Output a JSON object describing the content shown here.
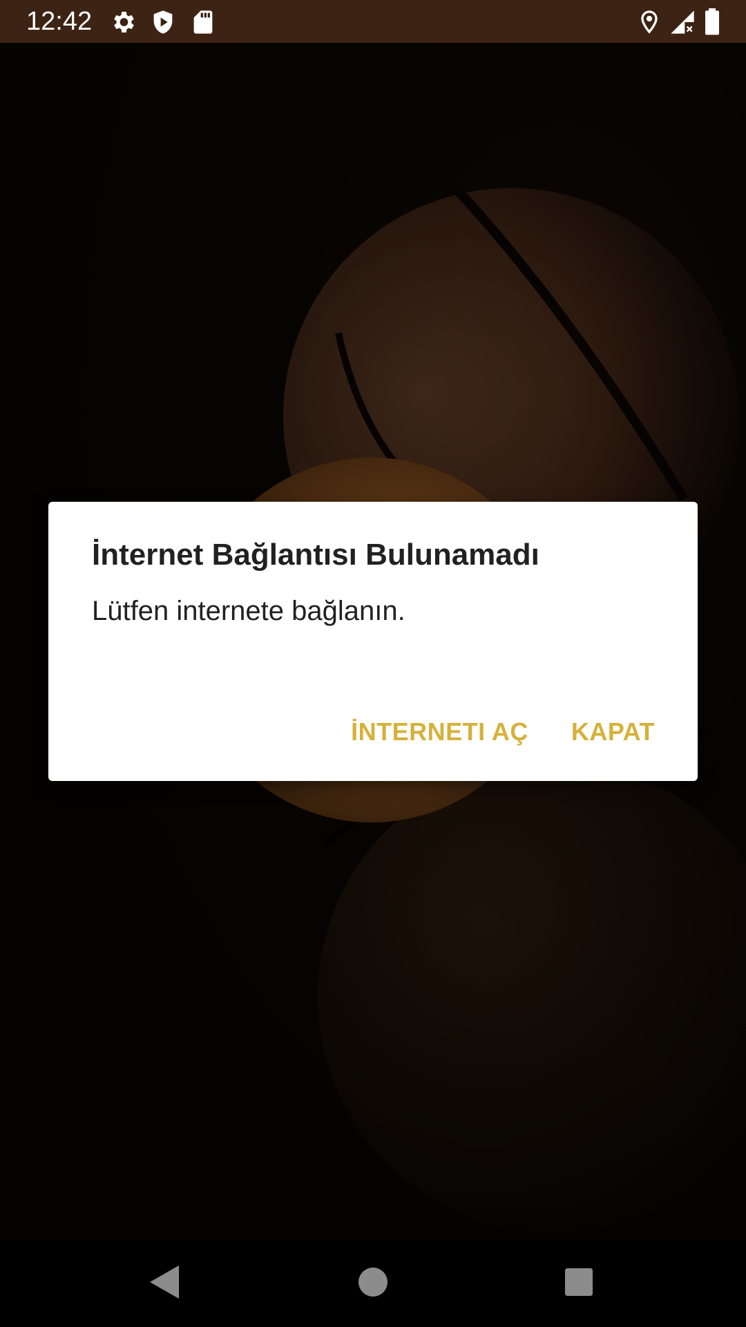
{
  "status_bar": {
    "time": "12:42",
    "left_icons": [
      "gear-icon",
      "shield-icon",
      "sd-card-icon"
    ],
    "right_icons": [
      "location-icon",
      "signal-no-data-icon",
      "battery-icon"
    ],
    "background": "#3d2314"
  },
  "dialog": {
    "title": "İnternet Bağlantısı Bulunamadı",
    "message": "Lütfen internete bağlanın.",
    "positive_button": "İNTERNETI AÇ",
    "negative_button": "KAPAT",
    "accent_color": "#d6b13a"
  },
  "nav_bar": {
    "back": "back-icon",
    "home": "home-icon",
    "recents": "recents-icon"
  }
}
